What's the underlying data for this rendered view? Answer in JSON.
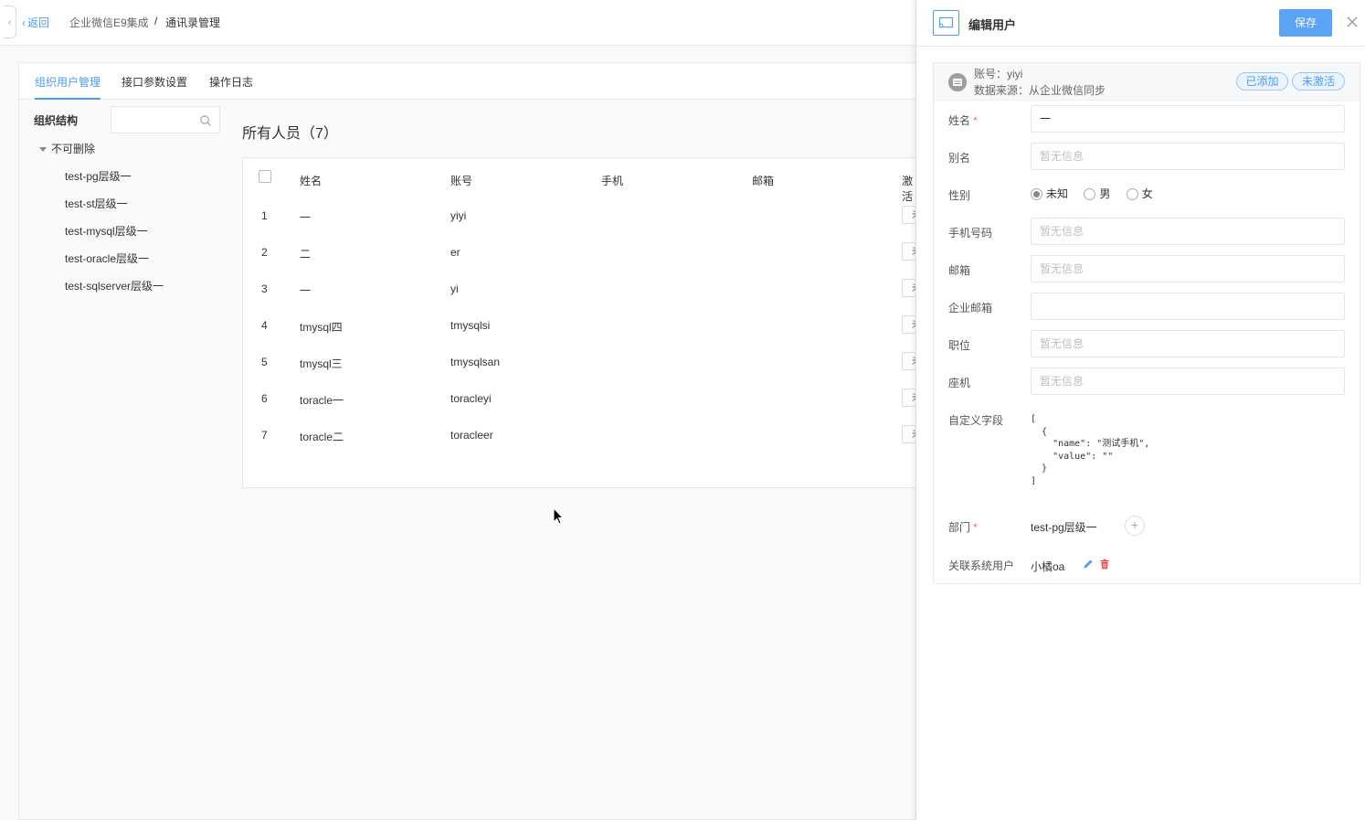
{
  "topbar": {
    "back_label": "返回",
    "breadcrumb_1": "企业微信E9集成",
    "breadcrumb_sep": "/",
    "breadcrumb_2": "通讯录管理"
  },
  "tabs": [
    {
      "label": "组织用户管理",
      "active": true
    },
    {
      "label": "接口参数设置",
      "active": false
    },
    {
      "label": "操作日志",
      "active": false
    }
  ],
  "org": {
    "title": "组织结构",
    "search_placeholder": "",
    "root": "不可删除",
    "items": [
      "test-pg层级一",
      "test-st层级一",
      "test-mysql层级一",
      "test-oracle层级一",
      "test-sqlserver层级一"
    ]
  },
  "people": {
    "title": "所有人员（7）",
    "columns": [
      "姓名",
      "账号",
      "手机",
      "邮箱",
      "激活"
    ],
    "rows": [
      {
        "no": "1",
        "name": "一",
        "account": "yiyi",
        "status": "未"
      },
      {
        "no": "2",
        "name": "二",
        "account": "er",
        "status": "未"
      },
      {
        "no": "3",
        "name": "一",
        "account": "yi",
        "status": "未"
      },
      {
        "no": "4",
        "name": "tmysql四",
        "account": "tmysqlsi",
        "status": "未"
      },
      {
        "no": "5",
        "name": "tmysql三",
        "account": "tmysqlsan",
        "status": "未"
      },
      {
        "no": "6",
        "name": "toracle一",
        "account": "toracleyi",
        "status": "未"
      },
      {
        "no": "7",
        "name": "toracle二",
        "account": "toracleer",
        "status": "未"
      }
    ]
  },
  "drawer": {
    "title": "编辑用户",
    "save_label": "保存",
    "account_line": "账号：yiyi",
    "source_line": "数据来源：从企业微信同步",
    "tag_added": "已添加",
    "tag_inactive": "未激活",
    "labels": {
      "name": "姓名",
      "alias": "别名",
      "gender": "性别",
      "mobile": "手机号码",
      "email": "邮箱",
      "biz_email": "企业邮箱",
      "position": "职位",
      "telephone": "座机",
      "custom": "自定义字段",
      "dept": "部门",
      "linked_user": "关联系统用户"
    },
    "values": {
      "name": "一",
      "alias": "暂无信息",
      "mobile": "暂无信息",
      "email": "暂无信息",
      "biz_email": "",
      "position": "暂无信息",
      "telephone": "暂无信息",
      "custom": "[\n  {\n    \"name\": \"测试手机\",\n    \"value\": \"\"\n  }\n]",
      "dept": "test-pg层级一",
      "linked_user": "小橘oa"
    },
    "gender_options": [
      "未知",
      "男",
      "女"
    ],
    "gender_selected": "未知",
    "required_mark": "*"
  },
  "colors": {
    "accent": "#4d9cf4",
    "required": "#f26b5b",
    "delete": "#f24b4b"
  }
}
